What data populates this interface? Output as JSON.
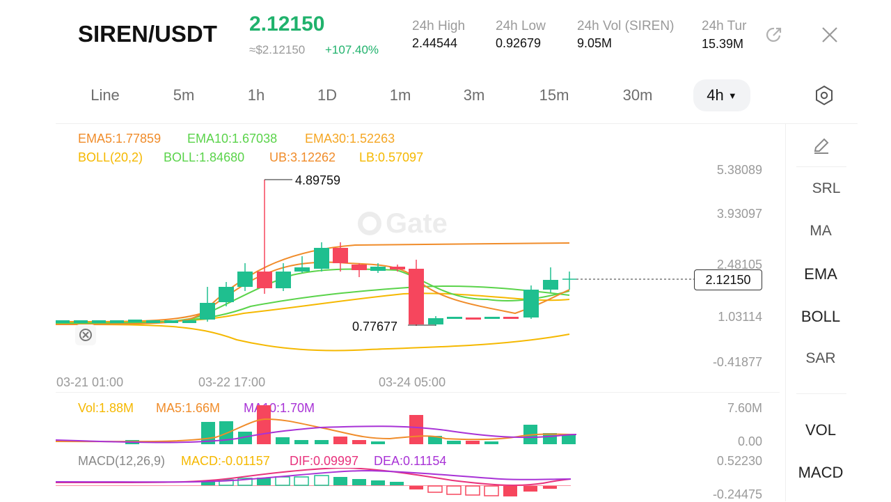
{
  "header": {
    "pair": "SIREN/USDT",
    "price": "2.12150",
    "price_usd": "≈$2.12150",
    "change": "+107.40%",
    "stats": [
      {
        "label": "24h  High",
        "value": "2.44544"
      },
      {
        "label": "24h  Low",
        "value": "0.92679"
      },
      {
        "label": "24h  Vol (SIREN)",
        "value": "9.05M"
      },
      {
        "label": "24h  Tur",
        "value": "15.39M"
      }
    ],
    "icons": {
      "share": "share-icon",
      "close": "close-icon"
    }
  },
  "timeframes": [
    "Line",
    "5m",
    "1h",
    "1D",
    "1m",
    "3m",
    "15m",
    "30m",
    "4h"
  ],
  "active_timeframe": "4h",
  "indicators": {
    "ema": [
      "EMA5:1.77859",
      "EMA10:1.67038",
      "EMA30:1.52263"
    ],
    "boll": [
      "BOLL(20,2)",
      "BOLL:1.84680",
      "UB:3.12262",
      "LB:0.57097"
    ],
    "vol": [
      "Vol:1.88M",
      "MA5:1.66M",
      "MA10:1.70M"
    ],
    "macd": [
      "MACD(12,26,9)",
      "MACD:-0.01157",
      "DIF:0.09997",
      "DEA:0.11154"
    ]
  },
  "price_axis": [
    "5.38089",
    "3.93097",
    "2.48105",
    "1.03114",
    "-0.41877"
  ],
  "time_axis": [
    "03-21 01:00",
    "03-22 17:00",
    "03-24 05:00"
  ],
  "vol_axis": [
    "7.60M",
    "0.00"
  ],
  "macd_axis": [
    "0.52230",
    "-0.24475"
  ],
  "markers": {
    "high": "4.89759",
    "low": "0.77677",
    "current": "2.12150"
  },
  "watermark": "Gate",
  "side_panel": [
    "SRL",
    "MA",
    "EMA",
    "BOLL",
    "SAR",
    "VOL",
    "MACD"
  ],
  "colors": {
    "up": "#1fbf8f",
    "down": "#f6465d",
    "accent": "#20b26c",
    "ema5": "#f08c2a",
    "ema10": "#5ad34a",
    "ema30": "#f5a623",
    "boll": "#f5b800",
    "macd_dif": "#e8327c",
    "macd_dea": "#a832d6"
  }
}
